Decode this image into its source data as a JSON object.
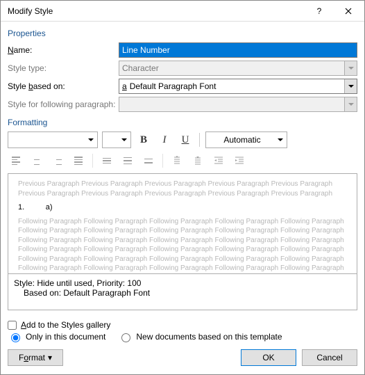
{
  "titlebar": {
    "title": "Modify Style"
  },
  "sections": {
    "properties": "Properties",
    "formatting": "Formatting"
  },
  "props": {
    "name_label": "Name:",
    "name_value": "Line Number",
    "type_label": "Style type:",
    "type_value": "Character",
    "based_label": "Style based on:",
    "based_value": "Default Paragraph Font",
    "following_label": "Style for following paragraph:",
    "following_value": ""
  },
  "format_toolbar": {
    "font_name": "",
    "font_size": "",
    "color_label": "Automatic"
  },
  "preview": {
    "ghost_prev": "Previous Paragraph Previous Paragraph Previous Paragraph Previous Paragraph Previous Paragraph Previous Paragraph Previous Paragraph Previous Paragraph Previous Paragraph Previous Paragraph",
    "sample": "1.          a)",
    "ghost_next": "Following Paragraph Following Paragraph Following Paragraph Following Paragraph Following Paragraph Following Paragraph Following Paragraph Following Paragraph Following Paragraph Following Paragraph Following Paragraph Following Paragraph Following Paragraph Following Paragraph Following Paragraph Following Paragraph Following Paragraph Following Paragraph Following Paragraph Following Paragraph Following Paragraph Following Paragraph Following Paragraph Following Paragraph Following Paragraph Following Paragraph Following Paragraph Following Paragraph Following Paragraph Following Paragraph"
  },
  "desc": {
    "line1": "Style: Hide until used, Priority: 100",
    "line2": "Based on: Default Paragraph Font"
  },
  "options": {
    "add_gallery": "Add to the Styles gallery",
    "only_doc": "Only in this document",
    "new_docs": "New documents based on this template"
  },
  "buttons": {
    "format": "Format",
    "ok": "OK",
    "cancel": "Cancel"
  }
}
